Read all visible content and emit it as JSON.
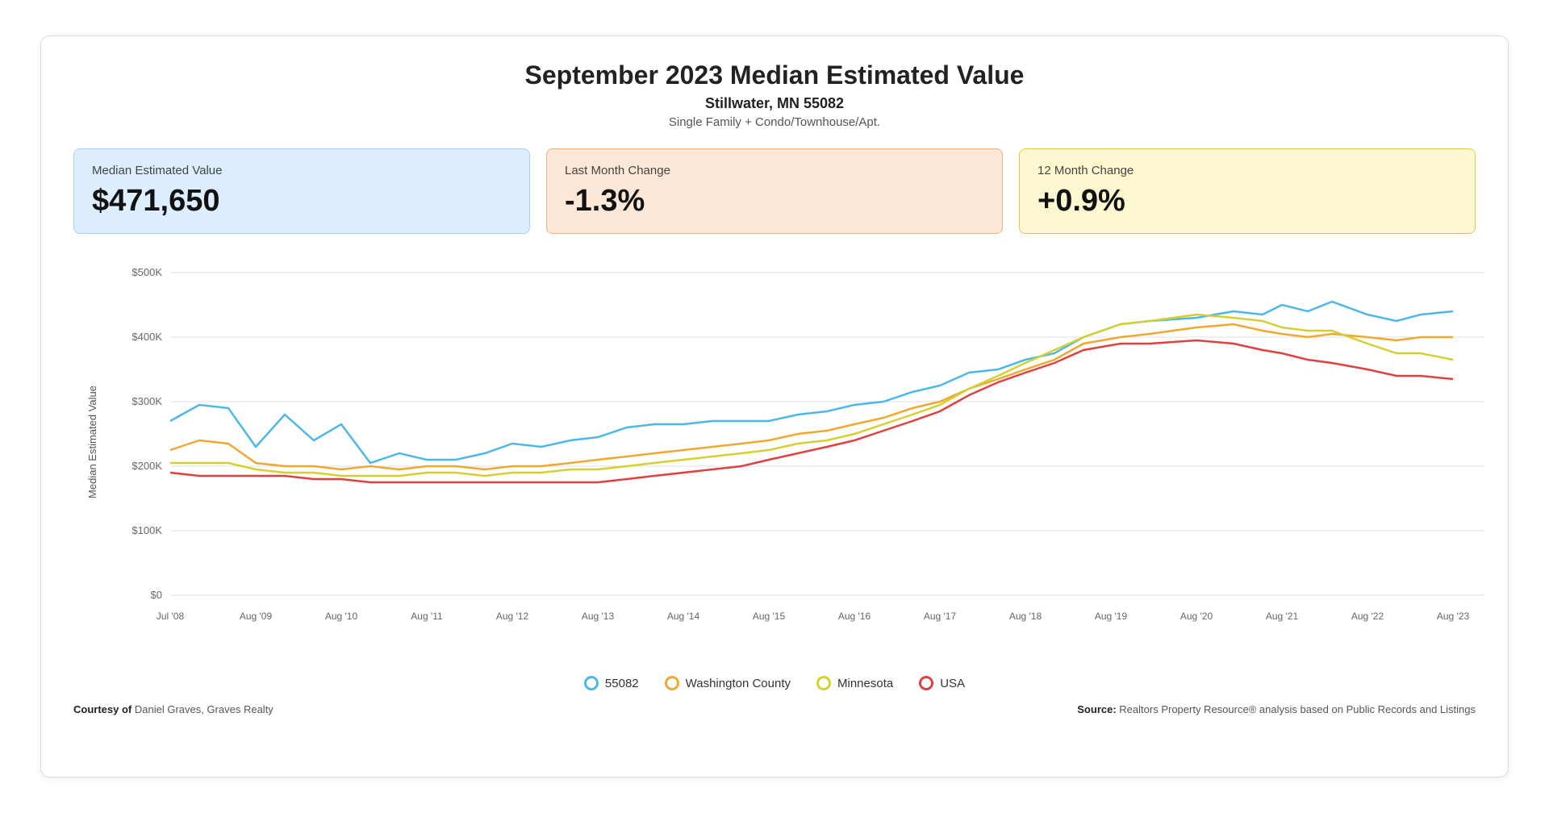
{
  "header": {
    "title": "September 2023 Median Estimated Value",
    "subtitle": "Stillwater, MN 55082",
    "description": "Single Family + Condo/Townhouse/Apt."
  },
  "stats": [
    {
      "id": "median-value",
      "label": "Median Estimated Value",
      "value": "$471,650",
      "color_class": "blue"
    },
    {
      "id": "last-month-change",
      "label": "Last Month Change",
      "value": "-1.3%",
      "color_class": "orange"
    },
    {
      "id": "twelve-month-change",
      "label": "12 Month Change",
      "value": "+0.9%",
      "color_class": "yellow"
    }
  ],
  "chart": {
    "y_axis_label": "Median Estimated Value",
    "y_labels": [
      "$500K",
      "$400K",
      "$300K",
      "$200K",
      "$100K",
      "$0"
    ],
    "x_labels": [
      "Jul '08",
      "Aug '09",
      "Aug '10",
      "Aug '11",
      "Aug '12",
      "Aug '13",
      "Aug '14",
      "Aug '15",
      "Aug '16",
      "Aug '17",
      "Aug '18",
      "Aug '19",
      "Aug '20",
      "Aug '21",
      "Aug '22",
      "Aug '23"
    ]
  },
  "legend": [
    {
      "id": "55082",
      "label": "55082",
      "color": "#4db8e8"
    },
    {
      "id": "washington-county",
      "label": "Washington County",
      "color": "#f0a830"
    },
    {
      "id": "minnesota",
      "label": "Minnesota",
      "color": "#d8d840"
    },
    {
      "id": "usa",
      "label": "USA",
      "color": "#e04040"
    }
  ],
  "footer": {
    "courtesy_label": "Courtesy of",
    "courtesy_text": "Daniel Graves, Graves Realty",
    "source_label": "Source:",
    "source_text": "Realtors Property Resource® analysis based on Public Records and Listings"
  }
}
